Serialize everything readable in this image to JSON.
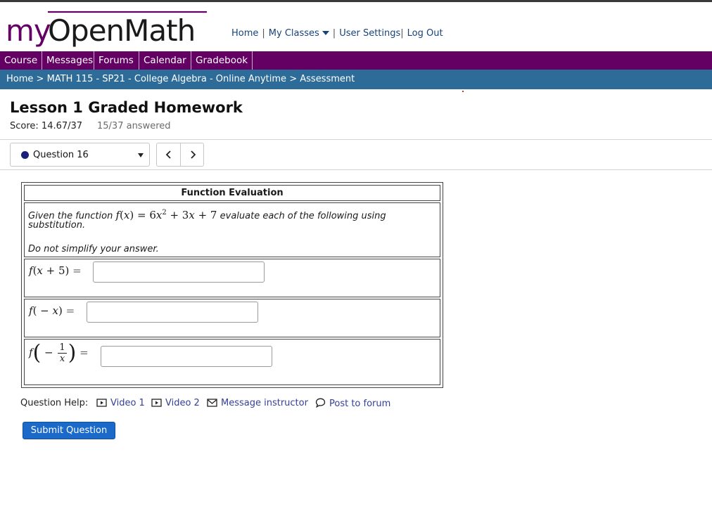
{
  "site": {
    "logo_text": "myOpenMath",
    "brand_colors": {
      "my": "#640064",
      "open_math": "#1a1a1a",
      "accent_line": "#640064"
    }
  },
  "top_nav": {
    "home": "Home",
    "my_classes": "My Classes",
    "user_settings": "User Settings",
    "log_out": "Log Out",
    "separator": "|"
  },
  "main_nav": [
    "Course",
    "Messages",
    "Forums",
    "Calendar",
    "Gradebook"
  ],
  "breadcrumb": {
    "items": [
      "Home",
      "MATH 115 - SP21 - College Algebra - Online Anytime",
      "Assessment"
    ],
    "separator": ">"
  },
  "assessment": {
    "title": "Lesson 1 Graded Homework",
    "score_label": "Score: 14.67/37",
    "answered": "15/37 answered"
  },
  "question_select": {
    "selected": "Question 16",
    "status_color": "#1a1f7a"
  },
  "question": {
    "header": "Function Evaluation",
    "intro_before": "Given the function",
    "intro_after": "evaluate each of the following using",
    "intro_line2": "substitution.",
    "note": "Do not simplify your answer.",
    "parts": [
      {
        "expr": "f(x + 5) =",
        "value": ""
      },
      {
        "expr": "f( − x) =",
        "value": ""
      },
      {
        "expr": "f(−1/x) =",
        "value": ""
      }
    ]
  },
  "question_help": {
    "label": "Question Help:",
    "links": [
      "Video 1",
      "Video 2",
      "Message instructor",
      "Post to forum"
    ]
  },
  "submit_label": "Submit Question",
  "colors": {
    "main_nav_bg": "#640064",
    "breadcrumb_bg": "#2d6c99",
    "submit_bg": "#1b6ac9",
    "link": "#34409a"
  }
}
